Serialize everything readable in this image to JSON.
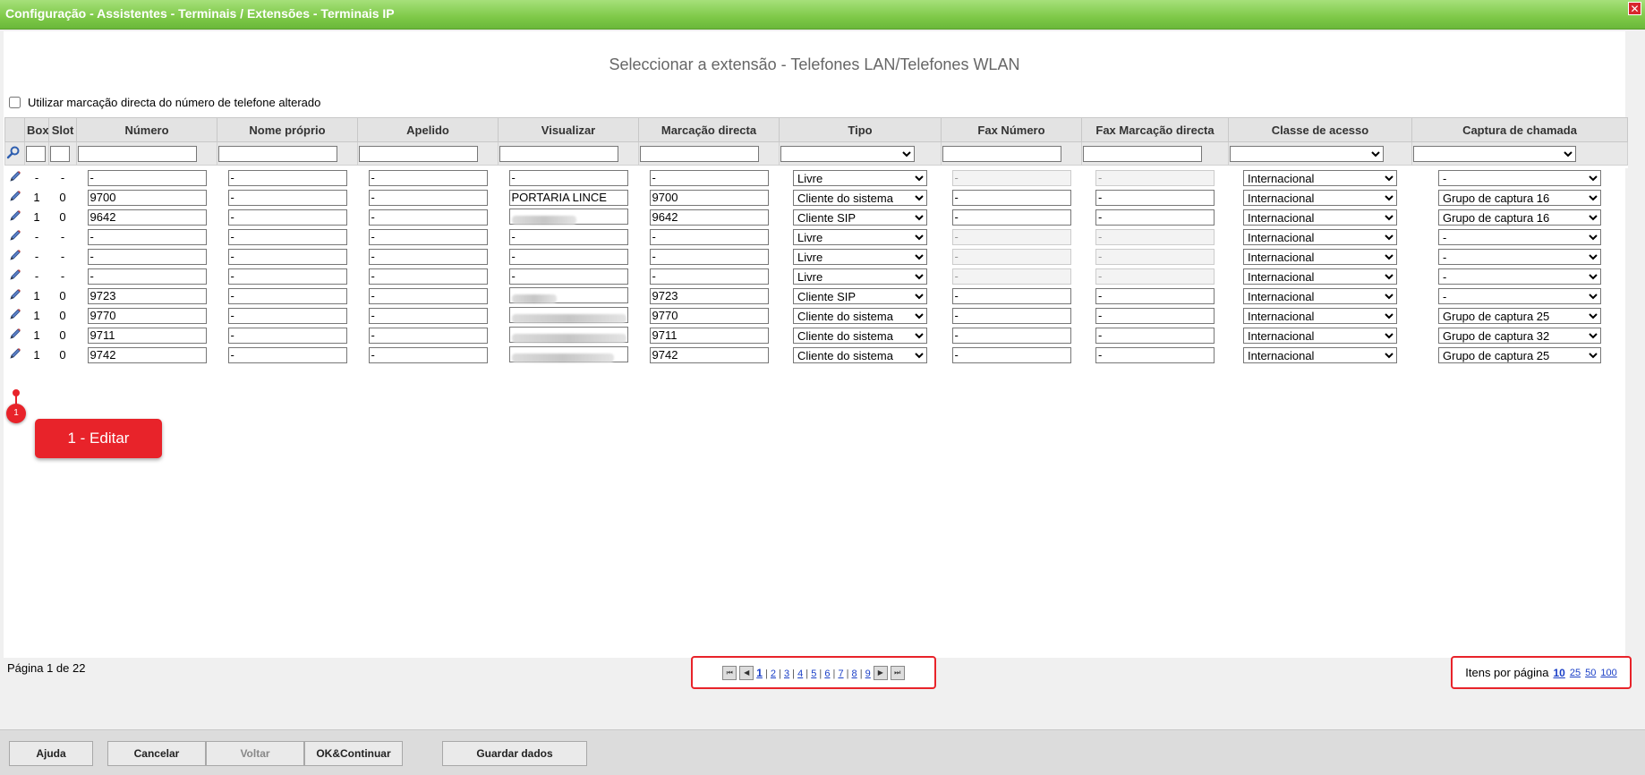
{
  "window": {
    "title": "Configuração - Assistentes - Terminais / Extensões - Terminais IP",
    "close_label": "✕"
  },
  "heading": "Seleccionar a extensão - Telefones LAN/Telefones WLAN",
  "option": {
    "label": "Utilizar marcação directa do número de telefone alterado",
    "checked": false
  },
  "columns": [
    "Box",
    "Slot",
    "Número",
    "Nome próprio",
    "Apelido",
    "Visualizar",
    "Marcação directa",
    "Tipo",
    "Fax Número",
    "Fax Marcação directa",
    "Classe de acesso",
    "Captura de chamada"
  ],
  "rows": [
    {
      "box": "-",
      "slot": "-",
      "numero": "-",
      "nome": "-",
      "apelido": "-",
      "visualizar": "-",
      "marcacao": "-",
      "tipo": "Livre",
      "fax_numero": "-",
      "fax_marcacao": "-",
      "classe": "Internacional",
      "captura": "-"
    },
    {
      "box": "1",
      "slot": "0",
      "numero": "9700",
      "nome": "-",
      "apelido": "-",
      "visualizar": "PORTARIA LINCE",
      "marcacao": "9700",
      "tipo": "Cliente do sistema",
      "fax_numero": "-",
      "fax_marcacao": "-",
      "classe": "Internacional",
      "captura": "Grupo de captura 16"
    },
    {
      "box": "1",
      "slot": "0",
      "numero": "9642",
      "nome": "-",
      "apelido": "-",
      "visualizar": "",
      "marcacao": "9642",
      "tipo": "Cliente SIP",
      "fax_numero": "-",
      "fax_marcacao": "-",
      "classe": "Internacional",
      "captura": "Grupo de captura 16"
    },
    {
      "box": "-",
      "slot": "-",
      "numero": "-",
      "nome": "-",
      "apelido": "-",
      "visualizar": "-",
      "marcacao": "-",
      "tipo": "Livre",
      "fax_numero": "-",
      "fax_marcacao": "-",
      "classe": "Internacional",
      "captura": "-"
    },
    {
      "box": "-",
      "slot": "-",
      "numero": "-",
      "nome": "-",
      "apelido": "-",
      "visualizar": "-",
      "marcacao": "-",
      "tipo": "Livre",
      "fax_numero": "-",
      "fax_marcacao": "-",
      "classe": "Internacional",
      "captura": "-"
    },
    {
      "box": "-",
      "slot": "-",
      "numero": "-",
      "nome": "-",
      "apelido": "-",
      "visualizar": "-",
      "marcacao": "-",
      "tipo": "Livre",
      "fax_numero": "-",
      "fax_marcacao": "-",
      "classe": "Internacional",
      "captura": "-"
    },
    {
      "box": "1",
      "slot": "0",
      "numero": "9723",
      "nome": "-",
      "apelido": "-",
      "visualizar": "",
      "marcacao": "9723",
      "tipo": "Cliente SIP",
      "fax_numero": "-",
      "fax_marcacao": "-",
      "classe": "Internacional",
      "captura": "-"
    },
    {
      "box": "1",
      "slot": "0",
      "numero": "9770",
      "nome": "-",
      "apelido": "-",
      "visualizar": "",
      "marcacao": "9770",
      "tipo": "Cliente do sistema",
      "fax_numero": "-",
      "fax_marcacao": "-",
      "classe": "Internacional",
      "captura": "Grupo de captura 25"
    },
    {
      "box": "1",
      "slot": "0",
      "numero": "9711",
      "nome": "-",
      "apelido": "-",
      "visualizar": "",
      "marcacao": "9711",
      "tipo": "Cliente do sistema",
      "fax_numero": "-",
      "fax_marcacao": "-",
      "classe": "Internacional",
      "captura": "Grupo de captura 32"
    },
    {
      "box": "1",
      "slot": "0",
      "numero": "9742",
      "nome": "-",
      "apelido": "-",
      "visualizar": "",
      "marcacao": "9742",
      "tipo": "Cliente do sistema",
      "fax_numero": "-",
      "fax_marcacao": "-",
      "classe": "Internacional",
      "captura": "Grupo de captura 25"
    }
  ],
  "annotation": {
    "marker": "1",
    "callout": "1 - Editar"
  },
  "pagination": {
    "info": "Página 1 de 22",
    "pages": [
      "1",
      "2",
      "3",
      "4",
      "5",
      "6",
      "7",
      "8",
      "9"
    ],
    "current": "1",
    "per_page_label": "Itens por página",
    "per_page_options": [
      "10",
      "25",
      "50",
      "100"
    ],
    "per_page_current": "10"
  },
  "buttons": {
    "help": "Ajuda",
    "cancel": "Cancelar",
    "back": "Voltar",
    "ok_continue": "OK&Continuar",
    "save": "Guardar dados"
  },
  "icons": {
    "edit": "pencil-icon",
    "search": "magnifier-icon"
  },
  "colors": {
    "titlebar": "#7ec948",
    "highlight": "#e8232a",
    "link": "#1a3fc7"
  }
}
